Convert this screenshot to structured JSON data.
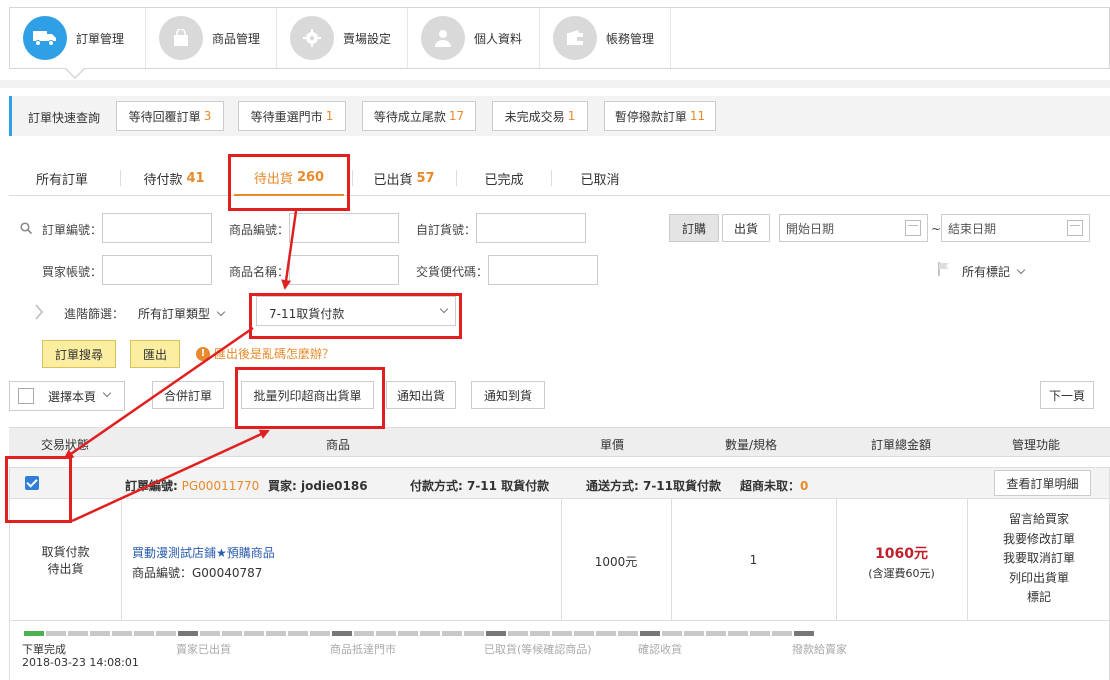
{
  "topnav": {
    "items": [
      {
        "label": "訂單管理",
        "icon": "truck-icon",
        "active": true
      },
      {
        "label": "商品管理",
        "icon": "bag-icon"
      },
      {
        "label": "賣場設定",
        "icon": "gear-icon"
      },
      {
        "label": "個人資料",
        "icon": "person-icon"
      },
      {
        "label": "帳務管理",
        "icon": "wallet-icon"
      }
    ]
  },
  "quick": {
    "title": "訂單快速查詢",
    "buttons": [
      {
        "label": "等待回覆訂單",
        "count": "3"
      },
      {
        "label": "等待重選門市",
        "count": "1"
      },
      {
        "label": "等待成立尾款",
        "count": "17"
      },
      {
        "label": "未完成交易",
        "count": "1"
      },
      {
        "label": "暫停撥款訂單",
        "count": "11"
      }
    ]
  },
  "tabs": [
    {
      "label": "所有訂單",
      "count": ""
    },
    {
      "label": "待付款",
      "count": "41"
    },
    {
      "label": "待出貨",
      "count": "260",
      "active": true
    },
    {
      "label": "已出貨",
      "count": "57"
    },
    {
      "label": "已完成",
      "count": ""
    },
    {
      "label": "已取消",
      "count": ""
    }
  ],
  "filter": {
    "order_no": "訂單編號：",
    "product_no": "商品編號：",
    "custom_no": "自訂貨號：",
    "buyer": "買家帳號：",
    "product_name": "商品名稱：",
    "pickup_code": "交貨便代碼：",
    "btn_order": "訂購",
    "btn_ship": "出貨",
    "start_date": "開始日期",
    "tilde": "~",
    "end_date": "結束日期",
    "all_marks": "所有標記",
    "advanced": "進階篩選：",
    "order_type": "所有訂單類型",
    "payment": "7-11取貨付款",
    "search": "訂單搜尋",
    "export": "匯出",
    "warn": "匯出後是亂碼怎麼辦？"
  },
  "actions": {
    "select_page": "選擇本頁",
    "merge": "合併訂單",
    "print": "批量列印超商出貨單",
    "notify_ship": "通知出貨",
    "notify_arrive": "通知到貨",
    "next": "下一頁"
  },
  "table": {
    "headers": [
      "交易狀態",
      "商品",
      "單價",
      "數量/規格",
      "訂單總金額",
      "管理功能"
    ],
    "order": {
      "no_label": "訂單編號:",
      "no": "PG00011770",
      "buyer": "買家: jodie0186",
      "payment": "付款方式: 7-11 取貨付款",
      "shipping": "通送方式: 7-11取貨付款",
      "store_label": "超商未取：",
      "store_val": "0",
      "detail": "查看訂單明細"
    },
    "row": {
      "status1": "取貨付款",
      "status2": "待出貨",
      "product": "買動漫測試店鋪★預購商品",
      "product_no": "商品編號：G00040787",
      "price": "1000元",
      "qty": "1",
      "total": "1060元",
      "total_note": "(含運費60元)",
      "manage": [
        "留言給買家",
        "我要修改訂單",
        "我要取消訂單",
        "列印出貨單",
        "標記"
      ]
    }
  },
  "progress": {
    "stages": [
      "下單完成",
      "賣家已出貨",
      "商品抵達門市",
      "已取貨(等候確認商品)",
      "確認收貨",
      "撥款給賣家"
    ],
    "timestamp": "2018-03-23 14:08:01"
  },
  "colors": {
    "accent": "#2f9fe6",
    "orange": "#e8892b",
    "annotation": "#e02020",
    "price": "#c0202a"
  }
}
